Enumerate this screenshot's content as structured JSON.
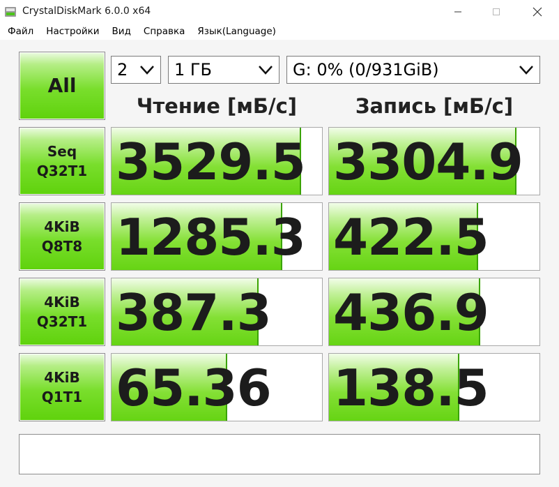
{
  "window": {
    "title": "CrystalDiskMark 6.0.0 x64",
    "controls": [
      "minimize",
      "maximize",
      "close"
    ]
  },
  "menu": [
    "Файл",
    "Настройки",
    "Вид",
    "Справка",
    "Язык(Language)"
  ],
  "toolbar": {
    "all_label": "All",
    "count": "2",
    "size": "1 ГБ",
    "drive": "G: 0% (0/931GiB)"
  },
  "headers": {
    "read": "Чтение [мБ/с]",
    "write": "Запись [мБ/с]"
  },
  "tests": [
    {
      "label": "Seq\nQ32T1",
      "read": "3529.5",
      "read_fill": 0.9,
      "write": "3304.9",
      "write_fill": 0.89
    },
    {
      "label": "4KiB\nQ8T8",
      "read": "1285.3",
      "read_fill": 0.81,
      "write": "422.5",
      "write_fill": 0.71
    },
    {
      "label": "4KiB\nQ32T1",
      "read": "387.3",
      "read_fill": 0.7,
      "write": "436.9",
      "write_fill": 0.72
    },
    {
      "label": "4KiB\nQ1T1",
      "read": "65.36",
      "read_fill": 0.55,
      "write": "138.5",
      "write_fill": 0.62
    }
  ],
  "status_text": "",
  "colors": {
    "accent_green": "#66d414",
    "bar_edge": "#3aa300",
    "background": "#f5f5f5"
  }
}
